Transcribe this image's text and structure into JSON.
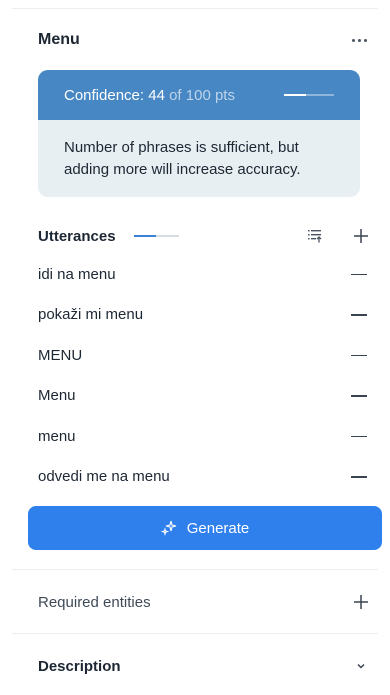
{
  "menu": {
    "title": "Menu",
    "more_icon": "more-horizontal-icon"
  },
  "confidence": {
    "label": "Confidence:",
    "score": "44",
    "of_text": "of 100 pts",
    "progress": 0.44,
    "message": "Number of phrases is sufficient, but adding more will increase accuracy.",
    "bar_color": "#4787c4",
    "card_color": "#e8eff2"
  },
  "utterances": {
    "title": "Utterances",
    "progress": 0.5,
    "sort_icon": "sort-list-icon",
    "add_icon": "plus-icon",
    "items": [
      {
        "text": "idi na menu"
      },
      {
        "text": "pokaži mi menu"
      },
      {
        "text": "MENU"
      },
      {
        "text": "Menu"
      },
      {
        "text": "menu"
      },
      {
        "text": "odvedi me na menu"
      }
    ]
  },
  "generate": {
    "label": "Generate",
    "icon": "sparkles-icon",
    "color": "#2f80ed"
  },
  "required_entities": {
    "label": "Required entities",
    "icon": "plus-icon"
  },
  "description": {
    "label": "Description",
    "icon": "chevron-down-icon"
  }
}
